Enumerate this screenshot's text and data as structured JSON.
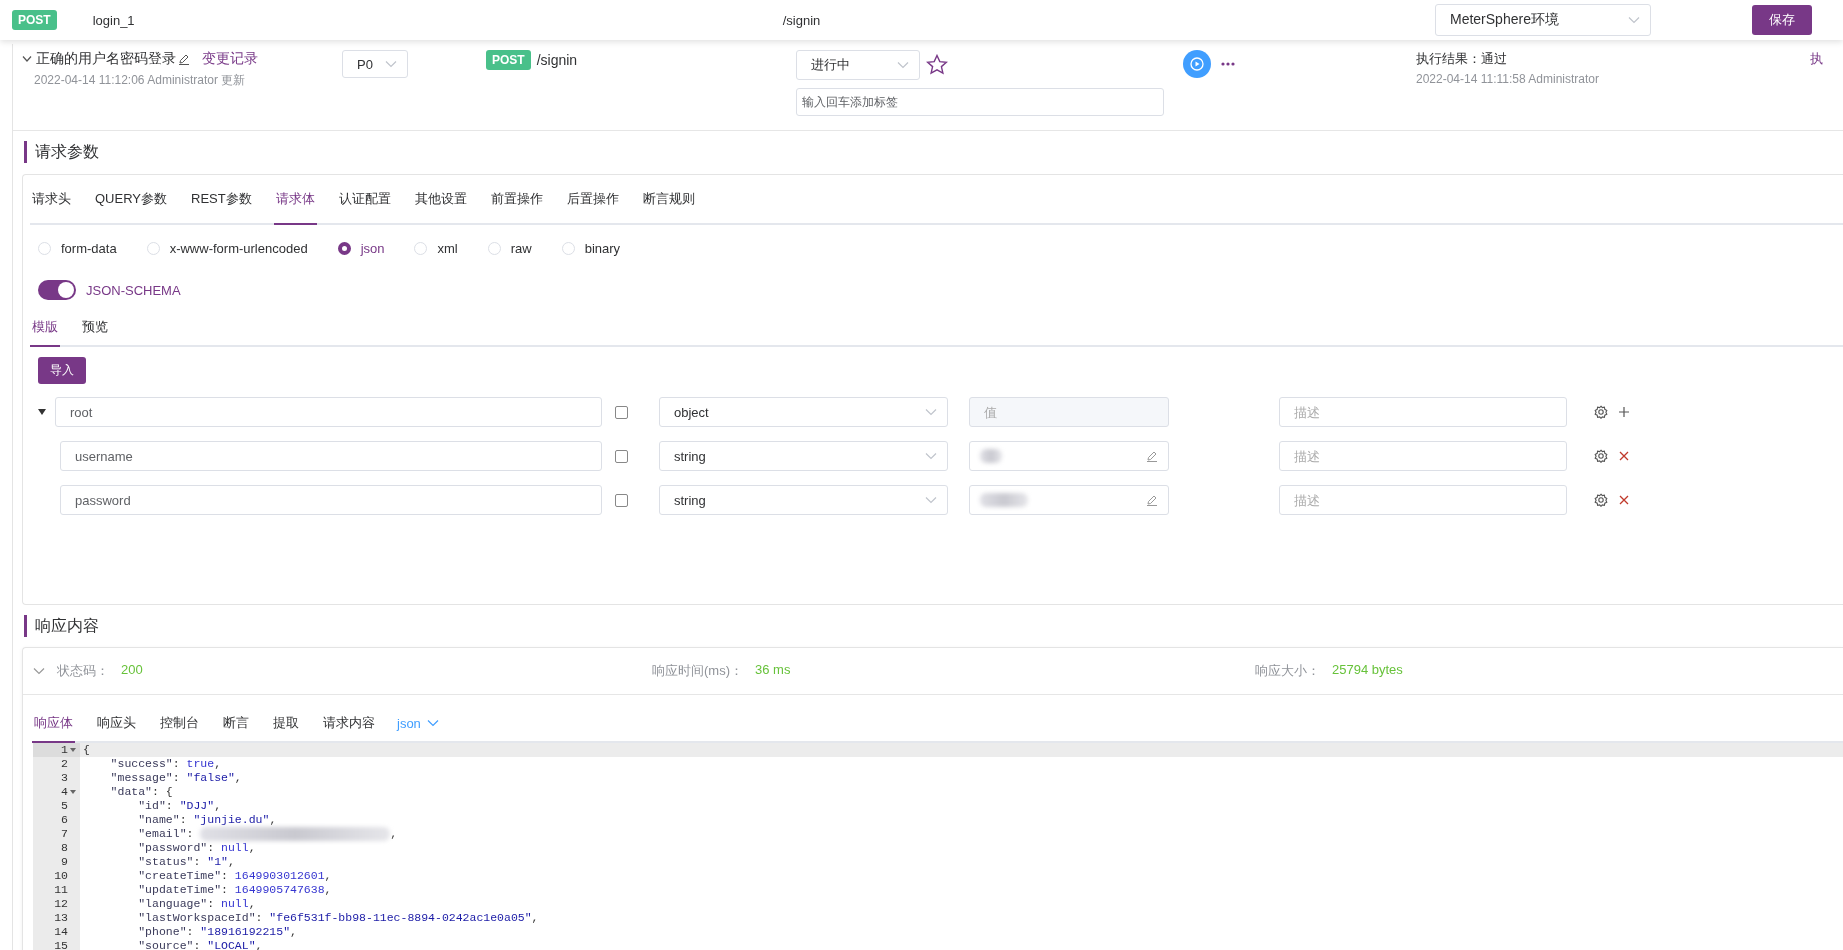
{
  "top_bar": {
    "method": "POST",
    "name": "login_1",
    "path": "/signin",
    "environment": "MeterSphere环境",
    "save_button": "保存"
  },
  "case_header": {
    "expanded": true,
    "title": "正确的用户名密码登录",
    "history_link": "变更记录",
    "updated": "2022-04-14 11:12:06 Administrator 更新",
    "priority": "P0",
    "method": "POST",
    "path": "/signin",
    "status": "进行中",
    "starred": false,
    "tag_input": {
      "placeholder": "输入回车添加标签"
    },
    "result": "执行结果：通过",
    "result_time": "2022-04-14 11:11:58 Administrator",
    "column_cut": "执"
  },
  "request": {
    "title": "请求参数",
    "tabs": [
      {
        "label": "请求头",
        "selected": false
      },
      {
        "label": "QUERY参数",
        "selected": false
      },
      {
        "label": "REST参数",
        "selected": false
      },
      {
        "label": "请求体",
        "selected": true
      },
      {
        "label": "认证配置",
        "selected": false
      },
      {
        "label": "其他设置",
        "selected": false
      },
      {
        "label": "前置操作",
        "selected": false
      },
      {
        "label": "后置操作",
        "selected": false
      },
      {
        "label": "断言规则",
        "selected": false
      }
    ],
    "body_types": [
      {
        "label": "form-data",
        "selected": false
      },
      {
        "label": "x-www-form-urlencoded",
        "selected": false
      },
      {
        "label": "json",
        "selected": true
      },
      {
        "label": "xml",
        "selected": false
      },
      {
        "label": "raw",
        "selected": false
      },
      {
        "label": "binary",
        "selected": false
      }
    ],
    "json_schema": {
      "label": "JSON-SCHEMA",
      "on": true
    },
    "schema_tabs": [
      {
        "label": "模版",
        "selected": true
      },
      {
        "label": "预览",
        "selected": false
      }
    ],
    "import_button": "导入",
    "schema_rows": [
      {
        "kind": "root",
        "name": "root",
        "expanded": true,
        "required": false,
        "type": "object",
        "value_placeholder": "值",
        "description_placeholder": "描述"
      },
      {
        "kind": "field",
        "name": "username",
        "required": false,
        "type": "string",
        "redacted": true,
        "description_placeholder": "描述"
      },
      {
        "kind": "field",
        "name": "password",
        "required": false,
        "type": "string",
        "redacted": true,
        "description_placeholder": "描述"
      }
    ]
  },
  "response": {
    "title": "响应内容",
    "expanded": true,
    "summary": [
      {
        "label": "状态码：",
        "value": "200"
      },
      {
        "label": "响应时间(ms)：",
        "value": "36 ms"
      },
      {
        "label": "响应大小：",
        "value": "25794 bytes"
      }
    ],
    "tabs": [
      {
        "label": "响应体",
        "selected": true
      },
      {
        "label": "响应头",
        "selected": false
      },
      {
        "label": "控制台",
        "selected": false
      },
      {
        "label": "断言",
        "selected": false
      },
      {
        "label": "提取",
        "selected": false
      },
      {
        "label": "请求内容",
        "selected": false
      }
    ],
    "format": "json",
    "code_lines": [
      {
        "number": "1",
        "text": "{",
        "fold": true,
        "current": true
      },
      {
        "number": "2",
        "text": "    \"success\": true,"
      },
      {
        "number": "3",
        "text": "    \"message\": \"false\","
      },
      {
        "number": "4",
        "text": "    \"data\": {",
        "fold": true
      },
      {
        "number": "5",
        "text": "        \"id\": \"DJJ\","
      },
      {
        "number": "6",
        "text": "        \"name\": \"junjie.du\","
      },
      {
        "number": "7",
        "text": "        \"email\": ",
        "redacted": true,
        "tail": ","
      },
      {
        "number": "8",
        "text": "        \"password\": null,"
      },
      {
        "number": "9",
        "text": "        \"status\": \"1\","
      },
      {
        "number": "10",
        "text": "        \"createTime\": 1649903012601,"
      },
      {
        "number": "11",
        "text": "        \"updateTime\": 1649905747638,"
      },
      {
        "number": "12",
        "text": "        \"language\": null,"
      },
      {
        "number": "13",
        "text": "        \"lastWorkspaceId\": \"fe6f531f-bb98-11ec-8894-0242ac1e0a05\","
      },
      {
        "number": "14",
        "text": "        \"phone\": \"18916192215\","
      },
      {
        "number": "15",
        "text": "        \"source\": \"LOCAL\","
      }
    ]
  }
}
